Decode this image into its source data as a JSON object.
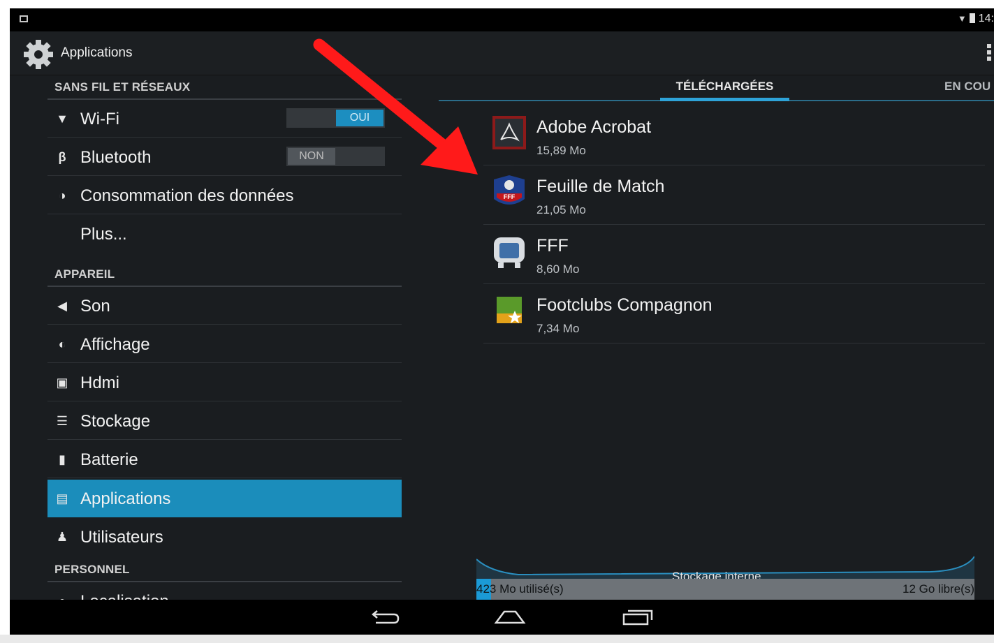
{
  "status_bar": {
    "time": "14:"
  },
  "action_bar": {
    "title": "Applications"
  },
  "left_panel": {
    "sections": [
      {
        "header": "SANS FIL ET RÉSEAUX"
      },
      {
        "header": "APPAREIL"
      },
      {
        "header": "PERSONNEL"
      }
    ],
    "items": [
      {
        "label": "Wi-Fi",
        "icon": "wifi-icon",
        "toggle": "OUI"
      },
      {
        "label": "Bluetooth",
        "icon": "bluetooth-icon",
        "toggle": "NON"
      },
      {
        "label": "Consommation des données",
        "icon": "data-usage-icon"
      },
      {
        "label": "Plus..."
      },
      {
        "label": "Son",
        "icon": "speaker-icon"
      },
      {
        "label": "Affichage",
        "icon": "brightness-icon"
      },
      {
        "label": "Hdmi",
        "icon": "hdmi-icon"
      },
      {
        "label": "Stockage",
        "icon": "storage-icon"
      },
      {
        "label": "Batterie",
        "icon": "battery-icon"
      },
      {
        "label": "Applications",
        "icon": "apps-icon",
        "selected": true
      },
      {
        "label": "Utilisateurs",
        "icon": "users-icon"
      },
      {
        "label": "Localisation",
        "icon": "location-pin-icon"
      }
    ]
  },
  "right_panel": {
    "tabs": [
      {
        "label": "TÉLÉCHARGÉES",
        "active": true
      },
      {
        "label": "EN COU"
      }
    ],
    "apps": [
      {
        "name": "Adobe Acrobat",
        "size": "15,89 Mo",
        "icon": "adobe-acrobat-icon"
      },
      {
        "name": "Feuille de Match",
        "size": "21,05 Mo",
        "icon": "fff-crest-icon"
      },
      {
        "name": "FFF",
        "size": "8,60 Mo",
        "icon": "fff-app-icon"
      },
      {
        "name": "Footclubs Compagnon",
        "size": "7,34 Mo",
        "icon": "footclubs-icon"
      }
    ],
    "storage": {
      "label": "Stockage interne",
      "used": "423 Mo utilisé(s)",
      "free": "12 Go libre(s)",
      "used_fraction": 0.03
    }
  },
  "colors": {
    "accent": "#1b8dbb",
    "annotation_arrow": "#ff1a1a"
  }
}
